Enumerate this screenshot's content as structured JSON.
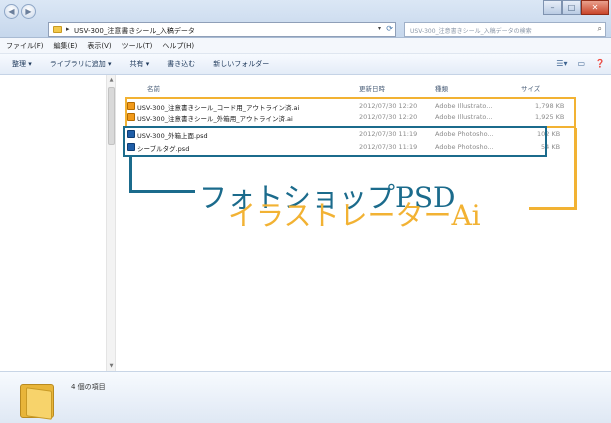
{
  "titlebar": {
    "address_path": "USV-300_注意書きシール_入稿データ",
    "search_placeholder": "USV-300_注意書きシール_入稿データの検索"
  },
  "menubar": {
    "items": [
      "ファイル(F)",
      "編集(E)",
      "表示(V)",
      "ツール(T)",
      "ヘルプ(H)"
    ]
  },
  "toolbar": {
    "items": [
      "整理 ▾",
      "ライブラリに追加 ▾",
      "共有 ▾",
      "書き込む",
      "新しいフォルダー"
    ]
  },
  "file_list": {
    "columns": [
      "名前",
      "更新日時",
      "種類",
      "サイズ"
    ],
    "rows": [
      {
        "name": "USV-300_注意書きシール_コード用_アウトライン済.ai",
        "date": "2012/07/30 12:20",
        "type": "Adobe Illustrato...",
        "size": "1,798 KB",
        "icon": "illustrator-file-icon"
      },
      {
        "name": "USV-300_注意書きシール_外箱用_アウトライン済.ai",
        "date": "2012/07/30 12:20",
        "type": "Adobe Illustrato...",
        "size": "1,925 KB",
        "icon": "illustrator-file-icon"
      },
      {
        "name": "USV-300_外箱上面.psd",
        "date": "2012/07/30 11:19",
        "type": "Adobe Photosho...",
        "size": "102 KB",
        "icon": "photoshop-file-icon"
      },
      {
        "name": "シーブルタグ.psd",
        "date": "2012/07/30 11:19",
        "type": "Adobe Photosho...",
        "size": "54 KB",
        "icon": "photoshop-file-icon"
      }
    ]
  },
  "annotations": {
    "photoshop_label": "フォトショップPSD",
    "illustrator_label": "イラストレーターAi",
    "photoshop_color": "#1b6b8c",
    "illustrator_color": "#f2b233"
  },
  "statusbar": {
    "item_count": "4 個の項目"
  }
}
